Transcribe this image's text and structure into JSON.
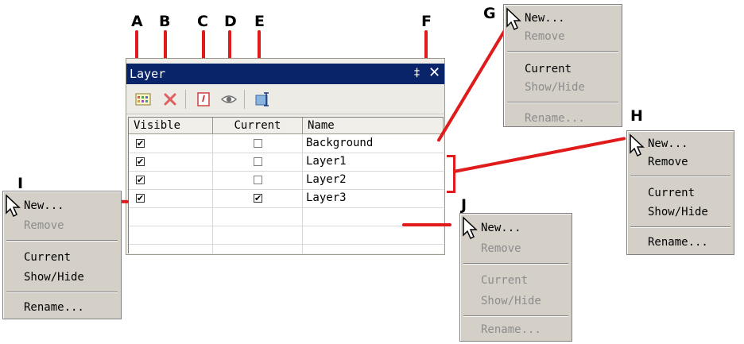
{
  "callouts": {
    "a": "A",
    "b": "B",
    "c": "C",
    "d": "D",
    "e": "E",
    "f": "F",
    "g": "G",
    "h": "H",
    "i": "I",
    "j": "J"
  },
  "panel": {
    "title": "Layer",
    "pin_glyph": "‡",
    "close_glyph": "✕",
    "toolbar_icons": [
      "new-layer-icon",
      "remove-layer-icon",
      "set-current-icon",
      "show-hide-icon",
      "rename-icon"
    ],
    "columns": [
      "Visible",
      "Current",
      "Name"
    ],
    "check_glyph": "✔",
    "rows": [
      {
        "visible": true,
        "current": false,
        "name": "Background"
      },
      {
        "visible": true,
        "current": false,
        "name": "Layer1"
      },
      {
        "visible": true,
        "current": false,
        "name": "Layer2"
      },
      {
        "visible": true,
        "current": true,
        "name": "Layer3"
      }
    ]
  },
  "menus": {
    "g": {
      "new": "New...",
      "remove": "Remove",
      "current": "Current",
      "showhide": "Show/Hide",
      "rename": "Rename...",
      "enabled": {
        "new": true,
        "remove": false,
        "current": true,
        "showhide": false,
        "rename": false
      }
    },
    "h": {
      "new": "New...",
      "remove": "Remove",
      "current": "Current",
      "showhide": "Show/Hide",
      "rename": "Rename...",
      "enabled": {
        "new": true,
        "remove": true,
        "current": true,
        "showhide": true,
        "rename": true
      }
    },
    "i": {
      "new": "New...",
      "remove": "Remove",
      "current": "Current",
      "showhide": "Show/Hide",
      "rename": "Rename...",
      "enabled": {
        "new": true,
        "remove": false,
        "current": true,
        "showhide": true,
        "rename": true
      }
    },
    "j": {
      "new": "New...",
      "remove": "Remove",
      "current": "Current",
      "showhide": "Show/Hide",
      "rename": "Rename...",
      "enabled": {
        "new": true,
        "remove": false,
        "current": false,
        "showhide": false,
        "rename": false
      }
    }
  },
  "colors": {
    "annotation": "#e01b1b",
    "titlebar": "#0a246a",
    "menu_bg": "#d4d0c8",
    "disabled_text": "#8c8c8c"
  }
}
